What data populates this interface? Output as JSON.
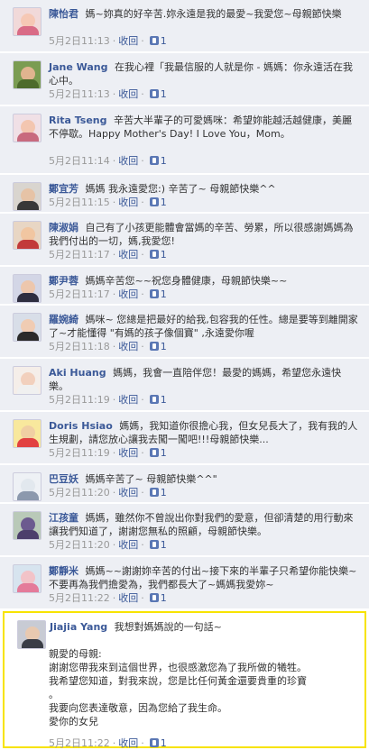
{
  "comments": [
    {
      "name": "陳怡君",
      "text": "媽~妳真的好辛苦.妳永遠是我的最愛~我愛您~母親節快樂",
      "time": "5月2日11:13",
      "reply": "收回",
      "likes": "1"
    },
    {
      "name": "Jane Wang",
      "text": "在我心裡「我最信服的人就是你 - 媽媽：你永遠活在我心中。",
      "time": "5月2日11:13",
      "reply": "收回",
      "likes": "1"
    },
    {
      "name": "Rita Tseng",
      "text": "辛苦大半輩子的可愛媽咪：希望妳能越活越健康，美麗不停歇。Happy Mother's Day! I Love You，Mom。",
      "time": "5月2日11:14",
      "reply": "收回",
      "likes": "1"
    },
    {
      "name": "鄭宜芳",
      "text": "媽媽 我永遠愛您:) 辛苦了~ 母親節快樂^^",
      "time": "5月2日11:15",
      "reply": "收回",
      "likes": "1"
    },
    {
      "name": "陳淑娟",
      "text": "自己有了小孩更能體會當媽的辛苦、勞累，所以很感謝媽媽為我們付出的一切，媽,我愛您!",
      "time": "5月2日11:17",
      "reply": "收回",
      "likes": "1"
    },
    {
      "name": "鄭尹蓉",
      "text": "媽媽辛苦您~~祝您身體健康，母親節快樂~~",
      "time": "5月2日11:17",
      "reply": "收回",
      "likes": "1"
    },
    {
      "name": "羅婉綺",
      "text": "媽咪~ 您總是把最好的給我,包容我的任性。總是要等到離開家了~才能懂得 \"有媽的孩子像個寶\" ,永遠愛你喔",
      "time": "5月2日11:18",
      "reply": "收回",
      "likes": "1"
    },
    {
      "name": "Aki Huang",
      "text": "媽媽，我會一直陪伴您！最愛的媽媽，希望您永遠快樂。",
      "time": "5月2日11:19",
      "reply": "收回",
      "likes": "1"
    },
    {
      "name": "Doris Hsiao",
      "text": "媽媽，我知道你很擔心我，但女兒長大了，我有我的人生規劃，請您放心讓我去闖一闖吧!!!母親節快樂...",
      "time": "5月2日11:19",
      "reply": "收回",
      "likes": "1"
    },
    {
      "name": "巴豆妖",
      "text": "媽媽辛苦了~ 母親節快樂^^\"",
      "time": "5月2日11:20",
      "reply": "收回",
      "likes": "1"
    },
    {
      "name": "江孩童",
      "text": "媽媽，雖然你不曾說出你對我們的愛意，但卻清楚的用行動來讓我們知道了，謝謝您無私的照顧，母親節快樂。",
      "time": "5月2日11:20",
      "reply": "收回",
      "likes": "1"
    },
    {
      "name": "鄭靜米",
      "text": "媽媽~~謝謝妳辛苦的付出~接下來的半輩子只希望你能快樂~不要再為我們擔愛為，我們都長大了~媽媽我愛妳~",
      "time": "5月2日11:22",
      "reply": "收回",
      "likes": "1"
    }
  ],
  "highlight": {
    "name": "Jiajia Yang",
    "title": "我想對媽媽說的一句話~",
    "lines": [
      "親愛的母親:",
      "謝謝您帶我來到這個世界，也很感激您為了我所做的犧牲。",
      "我希望您知道，對我來說，您是比任何黃金還要貴重的珍寶",
      "。",
      "我要向您表達敬意，因為您給了我生命。",
      "愛你的女兒"
    ],
    "time": "5月2日11:22",
    "reply": "收回",
    "likes": "1"
  },
  "colors": {
    "link": "#3b5998",
    "row_bg": "#edeff4",
    "highlight_border": "#f7e300"
  }
}
